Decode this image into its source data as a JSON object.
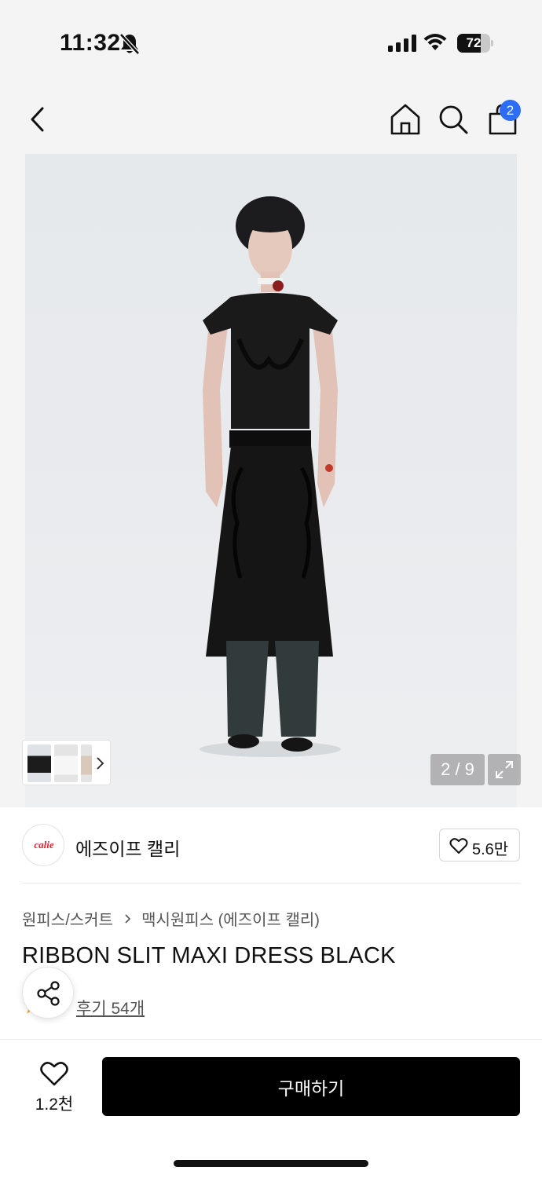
{
  "status_bar": {
    "time": "11:32",
    "battery": "72",
    "battery_level": 0.72,
    "icons": [
      "bell-slash-icon",
      "signal-icon",
      "wifi-icon",
      "battery-icon"
    ]
  },
  "nav": {
    "icons": [
      "chevron-left-icon",
      "home-icon",
      "search-icon",
      "shopping-bag-icon"
    ],
    "cart_count": "2"
  },
  "gallery": {
    "counter": "2 / 9",
    "image": "model wearing black sheer lace maxi dress over dark jeans",
    "thumb_icons": [
      "chevron-right-icon",
      "expand-icon"
    ]
  },
  "brand": {
    "logo_text": "calie",
    "name": "에즈이프 캘리",
    "likes": "5.6만"
  },
  "breadcrumb": {
    "category": "원피스/스커트",
    "subcategory": "맥시원피스 (에즈이프 캘리)"
  },
  "product": {
    "title": "RIBBON SLIT MAXI DRESS BLACK",
    "reviews": "후기 54개"
  },
  "bottom_bar": {
    "wish_count": "1.2천",
    "buy_label": "구매하기"
  },
  "colors": {
    "badge": "#2d6df6",
    "buy_button": "#000000",
    "brand_logo": "#e0242b",
    "star": "#f5a623"
  }
}
